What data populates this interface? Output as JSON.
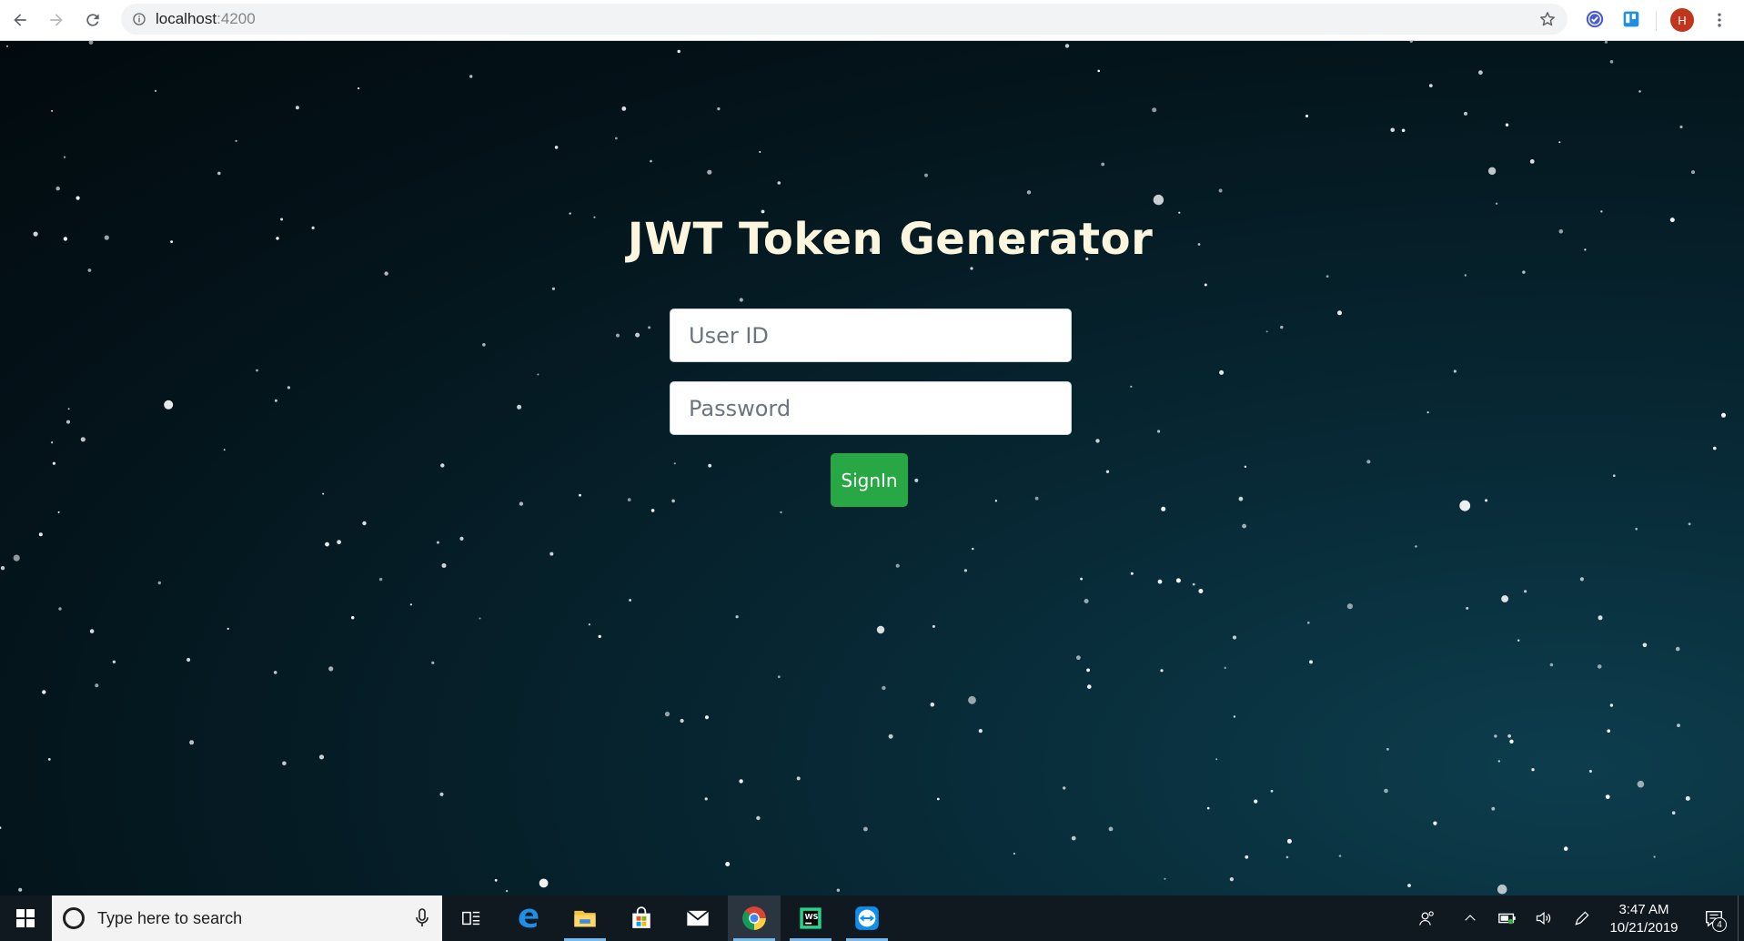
{
  "browser": {
    "url_host": "localhost",
    "url_port": ":4200",
    "profile_initial": "H"
  },
  "page": {
    "title": "JWT Token Generator",
    "user_id_placeholder": "User ID",
    "password_placeholder": "Password",
    "signin_label": "SignIn",
    "colors": {
      "title": "#fbf6dd",
      "button": "#28a745",
      "background": "#04151c"
    }
  },
  "taskbar": {
    "search_placeholder": "Type here to search",
    "apps": [
      "task-view",
      "edge",
      "file-explorer",
      "store",
      "mail",
      "chrome",
      "webstorm",
      "teamviewer"
    ],
    "time": "3:47 AM",
    "date": "10/21/2019",
    "notification_count": "4"
  }
}
